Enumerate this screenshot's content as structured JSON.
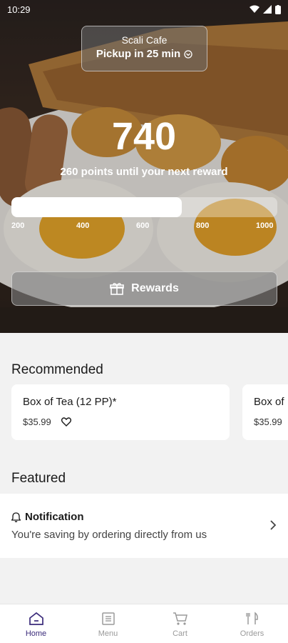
{
  "status_bar": {
    "time": "10:29"
  },
  "pickup": {
    "store_name": "Scali Cafe",
    "pickup_text": "Pickup in 25 min"
  },
  "rewards": {
    "points": "740",
    "subtitle": "260 points until your next reward",
    "progress_fraction": 0.64,
    "ticks": [
      "200",
      "400",
      "600",
      "800",
      "1000"
    ],
    "button_label": "Rewards"
  },
  "recommended": {
    "title": "Recommended",
    "items": [
      {
        "name": "Box of Tea (12 PP)*",
        "price": "$35.99"
      },
      {
        "name": "Box of",
        "price": "$35.99"
      }
    ]
  },
  "featured": {
    "title": "Featured",
    "notification": {
      "title": "Notification",
      "text": "You're saving by ordering directly from us"
    }
  },
  "tabs": [
    {
      "label": "Home",
      "icon": "home-icon",
      "active": true
    },
    {
      "label": "Menu",
      "icon": "menu-icon",
      "active": false
    },
    {
      "label": "Cart",
      "icon": "cart-icon",
      "active": false
    },
    {
      "label": "Orders",
      "icon": "orders-icon",
      "active": false
    }
  ],
  "colors": {
    "active_tab": "#3a2a7a",
    "inactive_tab": "#9a9a9a"
  }
}
